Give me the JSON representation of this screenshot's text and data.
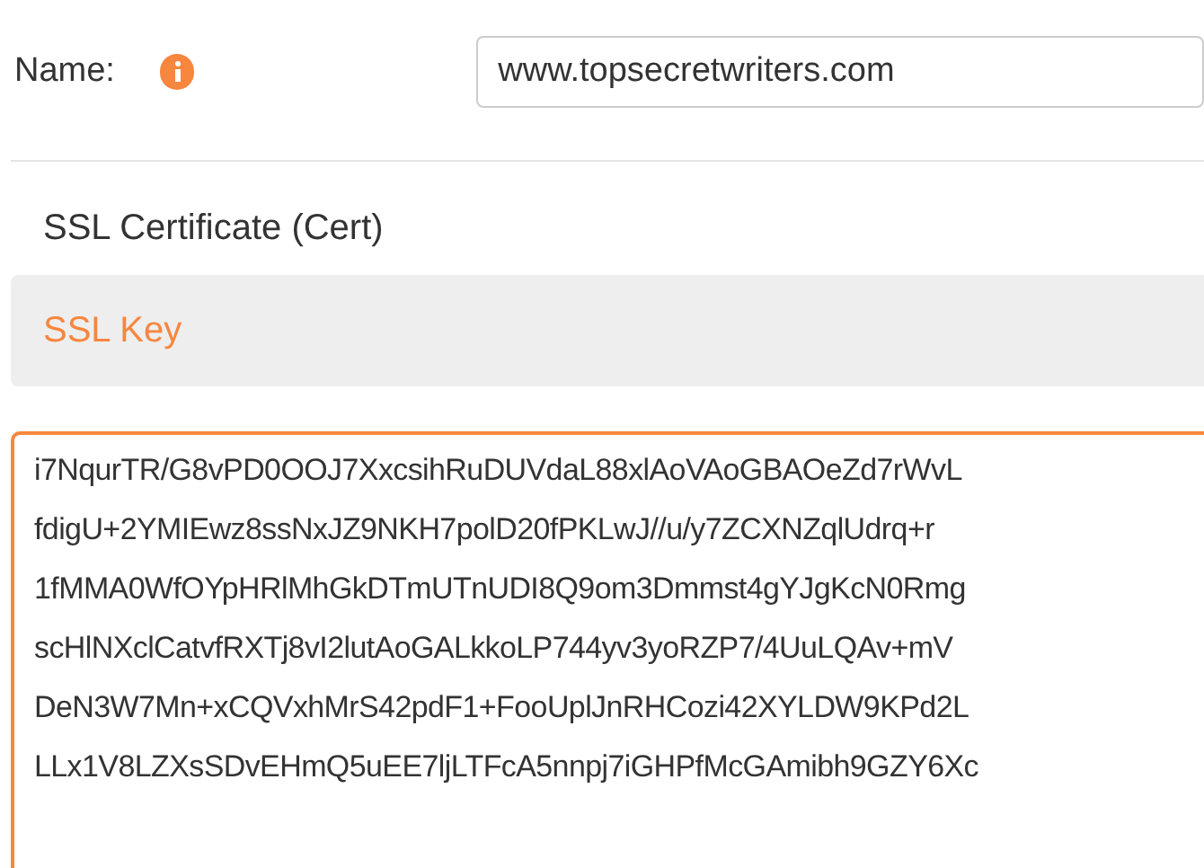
{
  "name_field": {
    "label": "Name:",
    "value": "www.topsecretwriters.com"
  },
  "tabs": [
    {
      "label": "SSL Certificate (Cert)",
      "selected": false
    },
    {
      "label": "SSL Key",
      "selected": true
    }
  ],
  "key_lines": [
    "i7NqurTR/G8vPD0OOJ7XxcsihRuDUVdaL88xlAoVAoGBAOeZd7rWvL",
    "fdigU+2YMIEwz8ssNxJZ9NKH7polD20fPKLwJ//u/y7ZCXNZqlUdrq+r",
    "1fMMA0WfOYpHRlMhGkDTmUTnUDI8Q9om3Dmmst4gYJgKcN0Rmg",
    "scHlNXclCatvfRXTj8vI2lutAoGALkkoLP744yv3yoRZP7/4UuLQAv+mV",
    "DeN3W7Mn+xCQVxhMrS42pdF1+FooUplJnRHCozi42XYLDW9KPd2L",
    "LLx1V8LZXsSDvEHmQ5uEE7ljLTFcA5nnpj7iGHPfMcGAmibh9GZY6Xc"
  ]
}
